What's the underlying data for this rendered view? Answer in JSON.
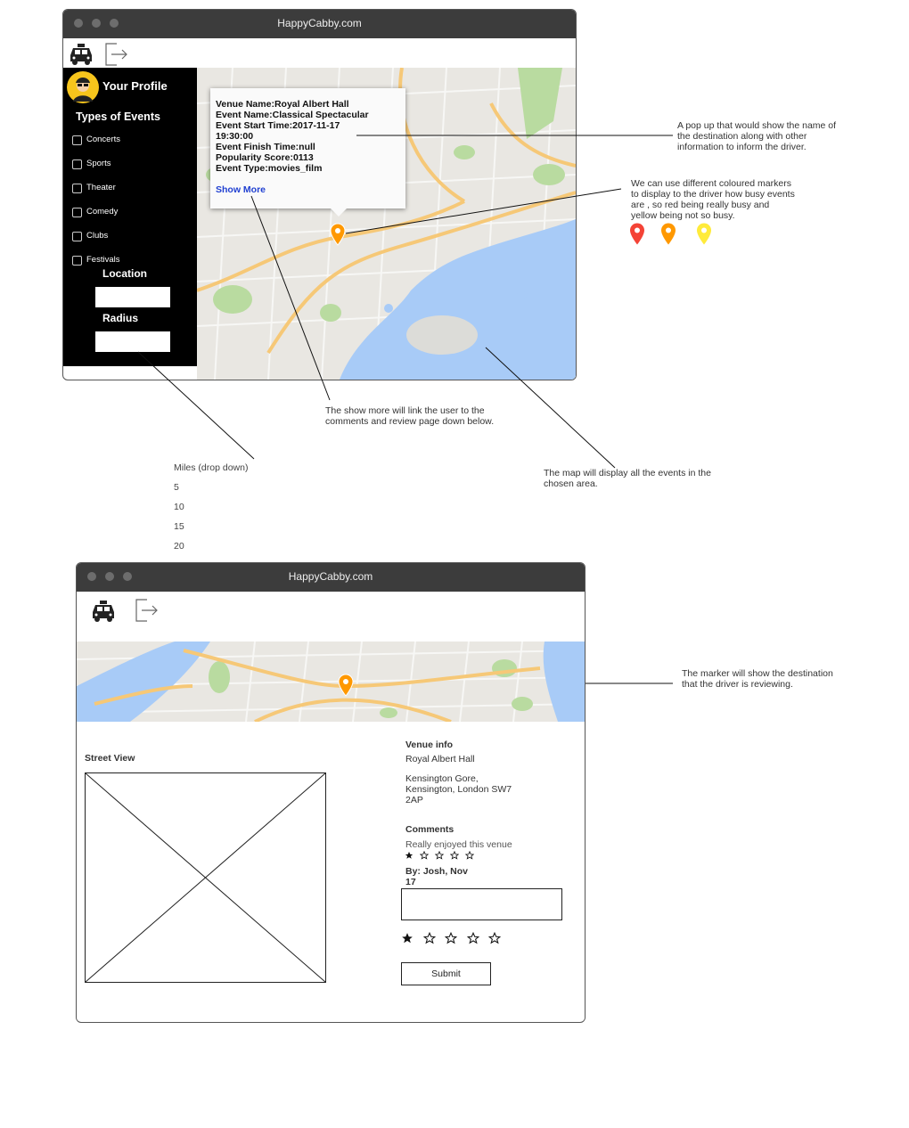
{
  "window": {
    "title": "HappyCabby.com"
  },
  "sidebar": {
    "profile_label": "Your Profile",
    "events_heading": "Types of Events",
    "event_types": [
      "Concerts",
      "Sports",
      "Theater",
      "Comedy",
      "Clubs",
      "Festivals"
    ],
    "location_label": "Location",
    "radius_label": "Radius"
  },
  "popup": {
    "lines": [
      "Venue Name:Royal Albert Hall",
      "Event Name:Classical Spectacular",
      "Event Start Time:2017-11-17",
      "19:30:00",
      "Event Finish Time:null",
      "Popularity Score:0113",
      "Event Type:movies_film"
    ],
    "show_more": "Show More"
  },
  "annotations": {
    "popup_note": "A pop up that would show the name of the destination along with other information to inform the driver.",
    "markers_note": "We can use different coloured markers to display to the driver how busy events are , so red being really busy and yellow being not so busy.",
    "show_more_note": "The show more will link the user to the comments and review page down below.",
    "map_note": "The map will display all the events in the chosen area.",
    "review_marker_note": "The marker will show the destination that the driver is reviewing."
  },
  "radius_dropdown": {
    "label": "Miles (drop down)",
    "options": [
      "5",
      "10",
      "15",
      "20"
    ]
  },
  "marker_colors": {
    "red": "#f44336",
    "orange": "#ff9800",
    "yellow": "#ffeb3b"
  },
  "review": {
    "street_view_label": "Street View",
    "venue_info_heading": "Venue info",
    "venue_name": "Royal Albert Hall",
    "venue_address_lines": [
      "Kensington Gore,",
      "Kensington, London SW7",
      "2AP"
    ],
    "comments_heading": "Comments",
    "comment_text": "Really enjoyed this venue",
    "comment_rating": 1,
    "comment_by_lines": [
      "By: Josh, Nov",
      "17"
    ],
    "new_rating": 1,
    "submit_label": "Submit"
  },
  "icons": {
    "taxi": "taxi-icon",
    "logout": "logout-icon",
    "avatar": "avatar-icon",
    "marker": "map-marker-icon",
    "star": "star-icon"
  }
}
